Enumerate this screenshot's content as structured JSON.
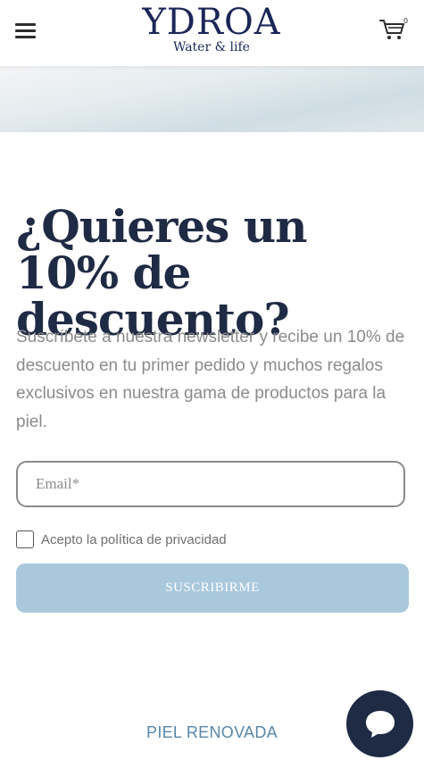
{
  "header": {
    "logo_title": "YDROA",
    "logo_tagline": "Water & life",
    "cart_count": "0"
  },
  "newsletter": {
    "headline": "¿Quieres un 10% de descuento?",
    "description": "Suscríbete a nuestra newsletter y recibe un 10% de descuento en tu primer pedido y muchos regalos exclusivos en nuestra gama de productos para la piel.",
    "email_placeholder": "Email*",
    "email_value": "",
    "privacy_label": "Acepto la política de privacidad",
    "privacy_checked": false,
    "submit_label": "SUSCRIBIRME"
  },
  "footer": {
    "next_section_label": "PIEL RENOVADA"
  },
  "icons": {
    "menu": "hamburger-menu-icon",
    "cart": "shopping-cart-icon",
    "chat": "chat-bubble-icon"
  },
  "colors": {
    "brand_navy": "#1b2657",
    "headline": "#1f2a44",
    "button_bg": "#a9c8dc",
    "link": "#5a87a8",
    "chat_bg": "#1f2a44"
  }
}
